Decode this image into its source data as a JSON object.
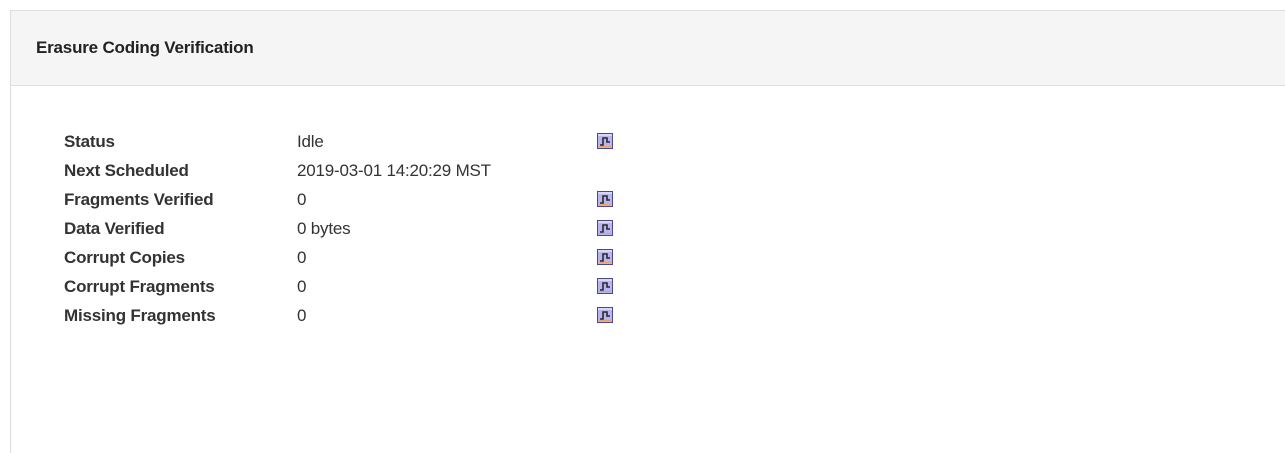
{
  "panel": {
    "title": "Erasure Coding Verification"
  },
  "rows": [
    {
      "label": "Status",
      "value": "Idle",
      "chart_icon": "chart-icon"
    },
    {
      "label": "Next Scheduled",
      "value": "2019-03-01 14:20:29 MST",
      "chart_icon": ""
    },
    {
      "label": "Fragments Verified",
      "value": "0",
      "chart_icon": "chart-icon"
    },
    {
      "label": "Data Verified",
      "value": "0 bytes",
      "chart_icon": "chart-icon"
    },
    {
      "label": "Corrupt Copies",
      "value": "0",
      "chart_icon": "chart-icon"
    },
    {
      "label": "Corrupt Fragments",
      "value": "0",
      "chart_icon": "chart-icon"
    },
    {
      "label": "Missing Fragments",
      "value": "0",
      "chart_icon": "chart-icon"
    }
  ],
  "colors": {
    "icon_background": "#b9b5ee",
    "icon_border": "#4c4a86",
    "icon_line": "#2a2a2a"
  }
}
